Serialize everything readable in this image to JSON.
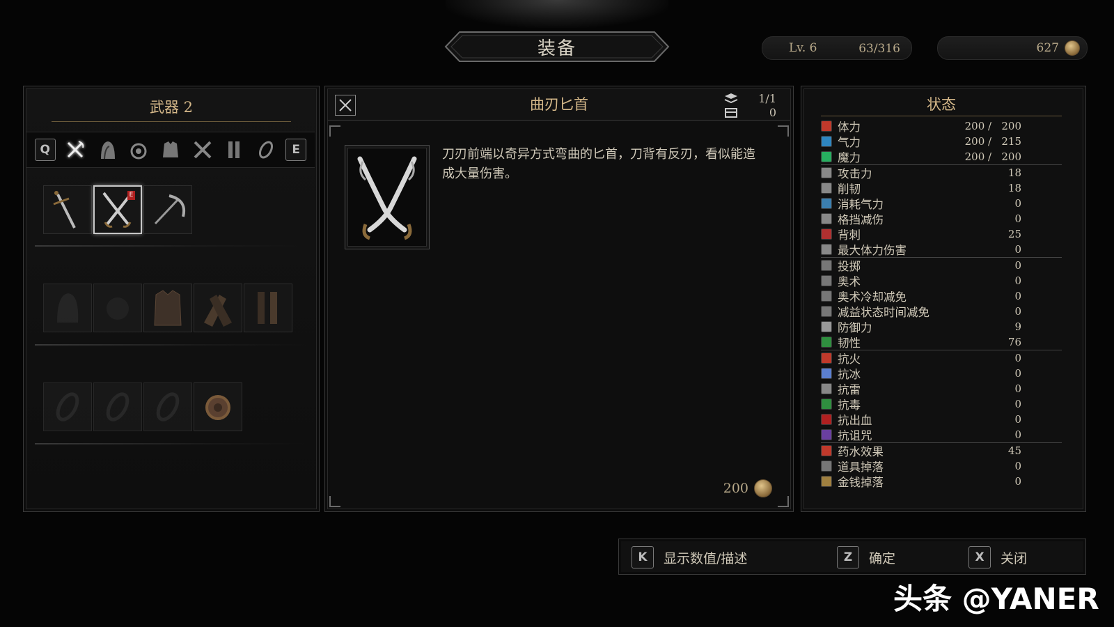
{
  "header": {
    "title": "装备",
    "level_label": "Lv. 6",
    "xp": "63/316",
    "gold": "627"
  },
  "left_panel": {
    "title": "武器 2",
    "tab_keys": {
      "prev": "Q",
      "next": "E"
    },
    "tabs": [
      "axe-icon",
      "hood-icon",
      "pouch-icon",
      "armor-icon",
      "tools-icon",
      "boots-icon",
      "ring-icon"
    ],
    "equipped_badge": "E"
  },
  "item": {
    "name": "曲刃匕首",
    "stack": "1/1",
    "stored": "0",
    "description": "刀刃前端以奇异方式弯曲的匕首，刀背有反刃，看似能造成大量伤害。",
    "price": "200"
  },
  "stats": {
    "title": "状态",
    "rows": [
      {
        "label": "体力",
        "value": "200 /   200",
        "color": "#c0392b"
      },
      {
        "label": "气力",
        "value": "200 /   215",
        "color": "#2e86c1"
      },
      {
        "label": "魔力",
        "value": "200 /   200",
        "color": "#27ae60"
      },
      {
        "label": "攻击力",
        "value": "18",
        "color": "#888888"
      },
      {
        "label": "削韧",
        "value": "18",
        "color": "#888888"
      },
      {
        "label": "消耗气力",
        "value": "0",
        "color": "#3b7fb0"
      },
      {
        "label": "格挡减伤",
        "value": "0",
        "color": "#888888"
      },
      {
        "label": "背刺",
        "value": "25",
        "color": "#b03030"
      },
      {
        "label": "最大体力伤害",
        "value": "0",
        "color": "#888888"
      },
      {
        "label": "投掷",
        "value": "0",
        "color": "#777777"
      },
      {
        "label": "奥术",
        "value": "0",
        "color": "#777777"
      },
      {
        "label": "奥术冷却减免",
        "value": "0",
        "color": "#777777"
      },
      {
        "label": "减益状态时间减免",
        "value": "0",
        "color": "#777777"
      },
      {
        "label": "防御力",
        "value": "9",
        "color": "#999999"
      },
      {
        "label": "韧性",
        "value": "76",
        "color": "#2f8f3f"
      },
      {
        "label": "抗火",
        "value": "0",
        "color": "#c0392b"
      },
      {
        "label": "抗冰",
        "value": "0",
        "color": "#5b7fd0"
      },
      {
        "label": "抗雷",
        "value": "0",
        "color": "#888888"
      },
      {
        "label": "抗毒",
        "value": "0",
        "color": "#2f8f3f"
      },
      {
        "label": "抗出血",
        "value": "0",
        "color": "#b02020"
      },
      {
        "label": "抗诅咒",
        "value": "0",
        "color": "#6a3fa0"
      },
      {
        "label": "药水效果",
        "value": "45",
        "color": "#c0392b"
      },
      {
        "label": "道具掉落",
        "value": "0",
        "color": "#777777"
      },
      {
        "label": "金钱掉落",
        "value": "0",
        "color": "#a08040"
      }
    ]
  },
  "footer": {
    "buttons": [
      {
        "key": "K",
        "label": "显示数值/描述"
      },
      {
        "key": "Z",
        "label": "确定"
      },
      {
        "key": "X",
        "label": "关闭"
      }
    ]
  },
  "watermark": "头条 @YANER"
}
